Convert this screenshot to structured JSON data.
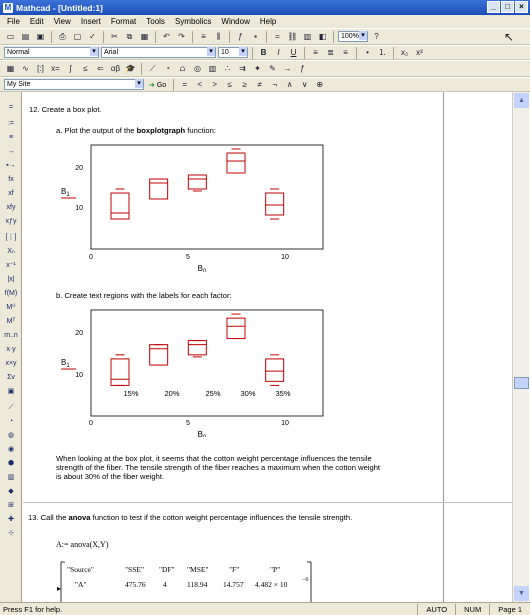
{
  "window": {
    "title": "Mathcad - [Untitled:1]",
    "app_icon": "M"
  },
  "menu": [
    "File",
    "Edit",
    "View",
    "Insert",
    "Format",
    "Tools",
    "Symbolics",
    "Window",
    "Help"
  ],
  "formatting": {
    "style": "Normal",
    "font": "Arial",
    "size": "10"
  },
  "toolbar": {
    "zoom": "100%"
  },
  "resources": {
    "site": "My Site",
    "go_label": "Go"
  },
  "doc": {
    "section12_heading": "12. Create a box plot.",
    "item_a": "a. Plot the output of the ",
    "item_a_bold": "boxplotgraph",
    "item_a_end": " function:",
    "item_b": "b. Create text regions with the labels for each factor:",
    "plot1": {
      "ylabel": "B",
      "ylabel_sub": "1",
      "xlabel": "B",
      "xlabel_sub": "0",
      "yticks": [
        "20",
        "10"
      ],
      "xticks": [
        "0",
        "5",
        "10"
      ]
    },
    "plot2": {
      "ylabel": "B",
      "ylabel_sub": "1",
      "xlabel": "B",
      "xlabel_sub": "0",
      "yticks": [
        "20",
        "10"
      ],
      "xticks": [
        "0",
        "5",
        "10"
      ],
      "labels": [
        "15%",
        "20%",
        "25%",
        "30%",
        "35%"
      ]
    },
    "conclusion": "When looking at the box plot, it seems that the cotton weight percentage influences the tensile strength of the fiber. The tensile strength of the fiber reaches a maximum when the cotton weight is about 30% of the fiber weight.",
    "section13_pre": "13. Call the ",
    "section13_bold": "anova",
    "section13_post": " function to test if the cotton weight percentage influences the tensile strength.",
    "anova_expr": "A:= anova(X,Y)",
    "anova_headers": [
      "\"Source\"",
      "\"SSE\"",
      "\"DF\"",
      "\"MSE\"",
      "\"F\"",
      "\"P\""
    ],
    "anova_row": [
      "\"A\"",
      "475.76",
      "4",
      "118.94",
      "14.757",
      "4.482 × 10"
    ],
    "anova_exp": "−6"
  },
  "status": {
    "help": "Press F1 for help.",
    "mode": "AUTO",
    "num": "NUM",
    "page": "Page 1"
  },
  "chart_data": [
    {
      "type": "box",
      "x_range": [
        0,
        12
      ],
      "y_range": [
        0,
        26
      ],
      "xticks": [
        0,
        5,
        10
      ],
      "yticks": [
        10,
        20
      ],
      "xlabel": "B0",
      "ylabel": "B1",
      "boxes": [
        {
          "x": 1.5,
          "min": 7.5,
          "q1": 7.5,
          "median": 9,
          "q3": 14,
          "max": 15
        },
        {
          "x": 3.5,
          "min": 12.5,
          "q1": 12.5,
          "median": 16.5,
          "q3": 17.5,
          "max": 17.5
        },
        {
          "x": 5.5,
          "min": 14.5,
          "q1": 15,
          "median": 17.5,
          "q3": 18.5,
          "max": 18.5
        },
        {
          "x": 7.5,
          "min": 19,
          "q1": 19,
          "median": 22,
          "q3": 24,
          "max": 25
        },
        {
          "x": 9.5,
          "min": 7.5,
          "q1": 8.5,
          "median": 11,
          "q3": 14,
          "max": 15
        }
      ]
    }
  ]
}
